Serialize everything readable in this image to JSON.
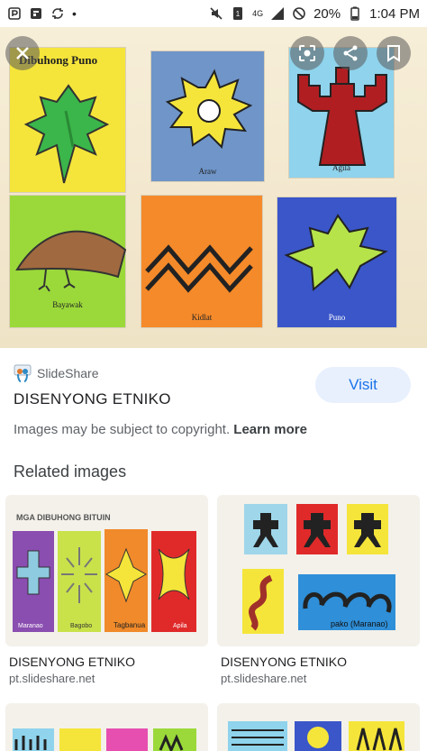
{
  "status_bar": {
    "battery_percent": "20%",
    "time": "1:04 PM",
    "network": "4G"
  },
  "hero": {
    "panels": [
      {
        "label": "Dibuhong Puno",
        "bg": "#f5e53a"
      },
      {
        "label": "Araw",
        "bg": "#6f95c9"
      },
      {
        "label": "Agila",
        "bg": "#8fd3ec"
      },
      {
        "label": "Bayawak",
        "bg": "#9bd93a"
      },
      {
        "label": "Kidlat",
        "bg": "#f58a2a"
      },
      {
        "label": "Puno",
        "bg": "#3a56c9"
      }
    ],
    "close_icon": "close-icon",
    "lens_icon": "lens-icon",
    "share_icon": "share-icon",
    "bookmark_icon": "bookmark-icon"
  },
  "source": {
    "site_name": "SlideShare",
    "title": "DISENYONG ETNIKO",
    "visit_label": "Visit",
    "copyright_text": "Images may be subject to copyright.",
    "learn_more": "Learn more"
  },
  "related": {
    "heading": "Related images",
    "items": [
      {
        "title": "DISENYONG ETNIKO",
        "source": "pt.slideshare.net",
        "thumb_heading": "MGA DIBUHONG BITUIN",
        "thumb_labels": [
          "Maranao",
          "Bagobo",
          "Tagbanua",
          "Apila"
        ]
      },
      {
        "title": "DISENYONG ETNIKO",
        "source": "pt.slideshare.net",
        "thumb_labels": [
          "pako (Maranao)"
        ]
      }
    ]
  },
  "colors": {
    "accent": "#1a73e8",
    "visit_bg": "#e8f0fe",
    "secondary_text": "#5f6368"
  }
}
